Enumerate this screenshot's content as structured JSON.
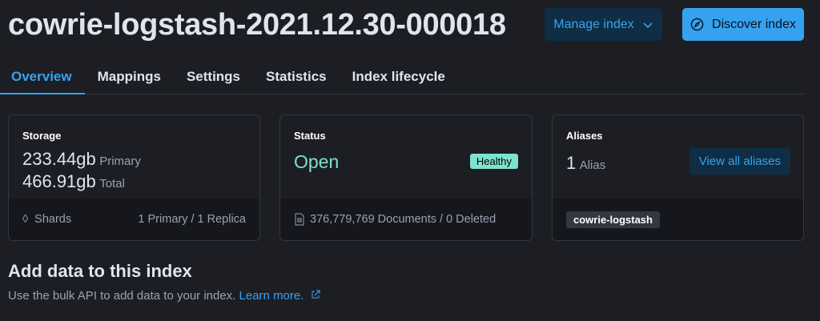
{
  "header": {
    "title": "cowrie-logstash-2021.12.30-000018",
    "manage_label": "Manage index",
    "discover_label": "Discover index"
  },
  "tabs": [
    "Overview",
    "Mappings",
    "Settings",
    "Statistics",
    "Index lifecycle"
  ],
  "storage": {
    "heading": "Storage",
    "primary_value": "233.44gb",
    "primary_label": "Primary",
    "total_value": "466.91gb",
    "total_label": "Total",
    "shards_label": "Shards",
    "shards_value": "1 Primary / 1 Replica"
  },
  "status": {
    "heading": "Status",
    "value": "Open",
    "health": "Healthy",
    "documents": "376,779,769 Documents / 0 Deleted"
  },
  "aliases": {
    "heading": "Aliases",
    "count": "1",
    "count_label": "Alias",
    "view_all_label": "View all aliases",
    "alias_tags": [
      "cowrie-logstash"
    ]
  },
  "add_data": {
    "heading": "Add data to this index",
    "text": "Use the bulk API to add data to your index.",
    "link": "Learn more."
  }
}
